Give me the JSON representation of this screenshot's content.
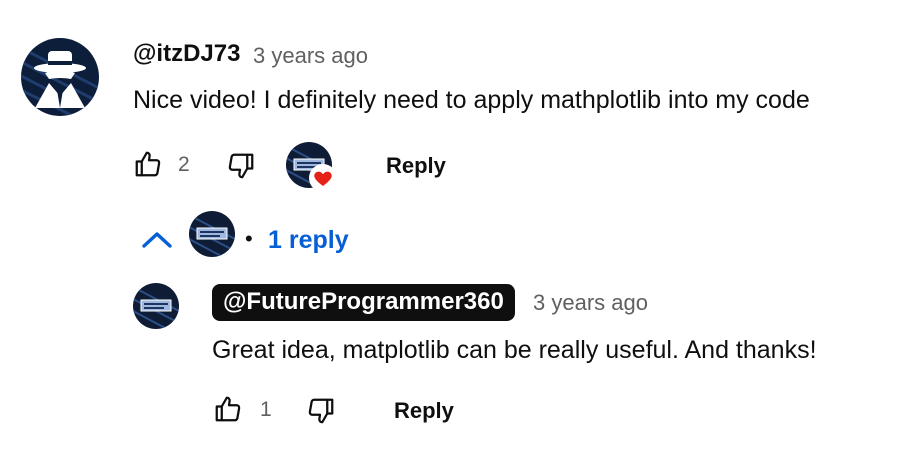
{
  "comment": {
    "author": "@itzDJ73",
    "time": "3 years ago",
    "text": "Nice video! I definitely need to apply mathplotlib into my code",
    "like_count": "2",
    "reply_label": "Reply",
    "creator_heart": true
  },
  "replies_toggle": {
    "label": "1 reply",
    "expanded": true,
    "separator": "•"
  },
  "reply": {
    "author": "@FutureProgrammer360",
    "time": "3 years ago",
    "text": "Great idea, matplotlib can be really useful. And thanks!",
    "like_count": "1",
    "reply_label": "Reply"
  },
  "colors": {
    "link_blue": "#065fd4",
    "heart_red": "#e62117",
    "meta_gray": "#606060"
  },
  "icons": {
    "like": "thumbs-up-icon",
    "dislike": "thumbs-down-icon",
    "heart": "heart-icon",
    "chevron": "chevron-up-icon"
  }
}
